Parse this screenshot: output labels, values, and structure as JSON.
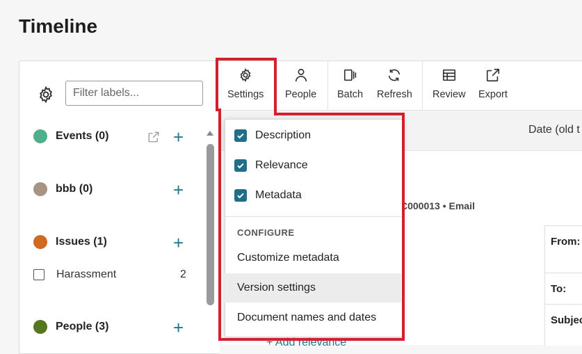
{
  "page": {
    "title": "Timeline"
  },
  "filter": {
    "placeholder": "Filter labels..."
  },
  "labels": [
    {
      "name": "Events (0)",
      "color": "#4fae8c"
    },
    {
      "name": "bbb (0)",
      "color": "#a89484"
    },
    {
      "name": "Issues (1)",
      "color": "#cf6a22",
      "children": [
        {
          "name": "Harassment",
          "count": "2"
        }
      ]
    },
    {
      "name": "People (3)",
      "color": "#55761f"
    }
  ],
  "toolbar": {
    "settings": "Settings",
    "people": "People",
    "batch": "Batch",
    "refresh": "Refresh",
    "review": "Review",
    "export": "Export"
  },
  "content": {
    "date_column": "Date (old t",
    "doc_id": "C000013 • Email",
    "from_label": "From:",
    "to_label": "To:",
    "subject_label": "Subjec",
    "add_relevance": "+ Add relevance"
  },
  "settings_menu": {
    "checkboxes": [
      {
        "label": "Description",
        "checked": true
      },
      {
        "label": "Relevance",
        "checked": true
      },
      {
        "label": "Metadata",
        "checked": true
      }
    ],
    "section_title": "CONFIGURE",
    "options": [
      {
        "label": "Customize metadata",
        "highlighted": false
      },
      {
        "label": "Version settings",
        "highlighted": true
      },
      {
        "label": "Document names and dates",
        "highlighted": false
      }
    ]
  },
  "colors": {
    "accent": "#1e7a8c",
    "checkbox": "#1f6f8b",
    "annotation": "#d4202e"
  }
}
